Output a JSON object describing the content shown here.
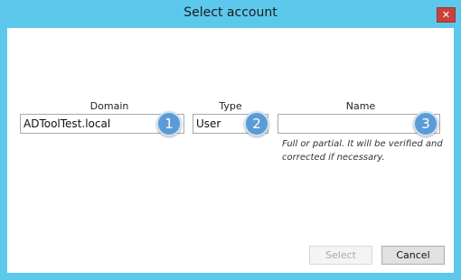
{
  "window": {
    "title": "Select account",
    "close_glyph": "✕"
  },
  "domain": {
    "label": "Domain",
    "value": "ADToolTest.local",
    "badge": "1"
  },
  "type": {
    "label": "Type",
    "value": "User",
    "badge": "2"
  },
  "name": {
    "label": "Name",
    "value": "",
    "badge": "3",
    "hint_line1": "Full or partial. It will be verified and",
    "hint_line2": "corrected if necessary."
  },
  "buttons": {
    "select": "Select",
    "cancel": "Cancel"
  },
  "colors": {
    "titlebar": "#5cc8ec",
    "badge": "#5b9bd5",
    "close": "#c7423a"
  }
}
